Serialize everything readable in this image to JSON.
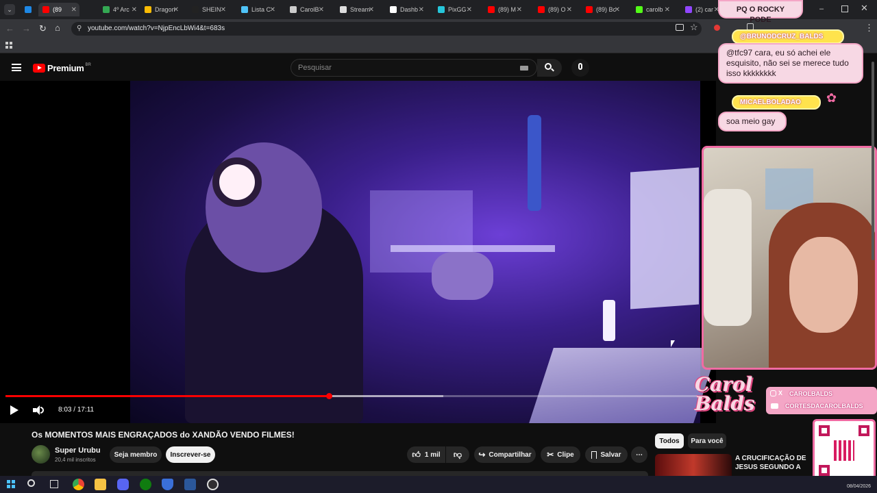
{
  "browser": {
    "tabs": [
      {
        "label": "",
        "color": "#1e88e5"
      },
      {
        "label": "(89",
        "color": "#ff0000",
        "active": true
      },
      {
        "label": "4º Arc",
        "color": "#34a853"
      },
      {
        "label": "Dragon",
        "color": "#fbbc05"
      },
      {
        "label": "SHEIN",
        "color": "#222222"
      },
      {
        "label": "Lista C",
        "color": "#4fc3f7"
      },
      {
        "label": "CarolB",
        "color": "#cccccc"
      },
      {
        "label": "Stream",
        "color": "#dddddd"
      },
      {
        "label": "Dashb",
        "color": "#ffffff"
      },
      {
        "label": "PixGG",
        "color": "#26c6da"
      },
      {
        "label": "(89) M",
        "color": "#ff0000"
      },
      {
        "label": "(89) O",
        "color": "#ff0000"
      },
      {
        "label": "(89) Bc",
        "color": "#ff0000"
      },
      {
        "label": "carolb",
        "color": "#53fc18"
      },
      {
        "label": "(2) car",
        "color": "#9146ff"
      }
    ],
    "url": "youtube.com/watch?v=NjpEncLbWi4&t=683s"
  },
  "youtube": {
    "brand": "Premium",
    "region": "BR",
    "search_placeholder": "Pesquisar"
  },
  "overlay": {
    "top_message": "PQ O ROCKY PODE",
    "chat": [
      {
        "user": "@BRUNODCRUZ_BALDS",
        "text": "@tfc97 cara, eu só achei ele esquisito, não sei se merece tudo isso kkkkkkkk"
      },
      {
        "user": "MICAELBOLADAO",
        "text": "soa meio gay"
      }
    ],
    "logo_text": "Carol Balds",
    "socials": [
      "CAROLBALDS",
      "CORTESDACAROLBALDS"
    ]
  },
  "player": {
    "time_current": "8:03",
    "time_separator": "/",
    "time_total": "17:11",
    "progress_fraction": 0.467,
    "buffer_fraction": 0.633
  },
  "video": {
    "title": "Os MOMENTOS MAIS ENGRAÇADOS do XANDÃO VENDO FILMES!",
    "channel": "Super Urubu",
    "subscribers": "20,4 mil inscritos",
    "member_label": "Seja membro",
    "subscribe_label": "Inscrever-se",
    "likes": "1 mil",
    "share_label": "Compartilhar",
    "clip_label": "Clipe",
    "save_label": "Salvar"
  },
  "sidebar": {
    "chips": [
      "Todos",
      "Para você"
    ],
    "recommendation_title": "A CRUCIFICAÇÃO DE JESUS SEGUNDO A MEDICINA"
  },
  "taskbar": {
    "date": "08/04/2026"
  }
}
